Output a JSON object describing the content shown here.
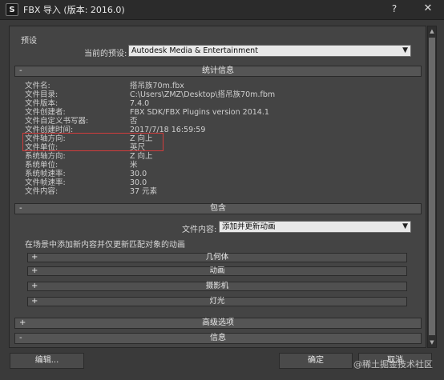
{
  "window": {
    "title": "FBX 导入 (版本: 2016.0)",
    "help_label": "?",
    "close_label": "✕"
  },
  "presets": {
    "group_label": "预设",
    "current_label": "当前的预设:",
    "current_value": "Autodesk Media & Entertainment"
  },
  "statistics": {
    "header": "统计信息",
    "rows": [
      {
        "key": "文件名:",
        "value": "搭吊族70m.fbx"
      },
      {
        "key": "文件目录:",
        "value": "C:\\Users\\ZMZ\\Desktop\\搭吊族70m.fbm"
      },
      {
        "key": "文件版本:",
        "value": "7.4.0"
      },
      {
        "key": "文件创建者:",
        "value": "FBX SDK/FBX Plugins version 2014.1"
      },
      {
        "key": "文件自定义书写器:",
        "value": "否"
      },
      {
        "key": "文件创建时间:",
        "value": "2017/7/18 16:59:59"
      },
      {
        "key": "文件轴方向:",
        "value": "Z 向上"
      },
      {
        "key": "文件单位:",
        "value": "英尺"
      },
      {
        "key": "系统轴方向:",
        "value": "Z 向上"
      },
      {
        "key": "系统单位:",
        "value": "米"
      },
      {
        "key": "系统帧速率:",
        "value": "30.0"
      },
      {
        "key": "文件帧速率:",
        "value": "30.0"
      },
      {
        "key": "文件内容:",
        "value": "37 元素"
      }
    ]
  },
  "include": {
    "header": "包含",
    "file_content_label": "文件内容:",
    "file_content_value": "添加并更新动画",
    "description": "在场景中添加新内容并仅更新匹配对象的动画",
    "subrollouts": [
      {
        "sign": "+",
        "label": "几何体"
      },
      {
        "sign": "+",
        "label": "动画"
      },
      {
        "sign": "+",
        "label": "摄影机"
      },
      {
        "sign": "+",
        "label": "灯光"
      }
    ]
  },
  "advanced": {
    "sign": "+",
    "label": "高级选项"
  },
  "info": {
    "sign": "-",
    "label": "信息"
  },
  "buttons": {
    "edit": "编辑...",
    "ok": "确定",
    "cancel": "取消"
  },
  "watermark": "@稀土掘金技术社区",
  "icons": {
    "app": "3dsmax-logo-icon",
    "collapse": "minus-sign",
    "expand": "plus-sign"
  }
}
